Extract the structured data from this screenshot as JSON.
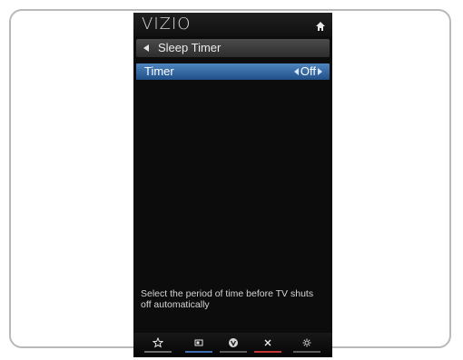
{
  "header": {
    "brand": "VIZIO"
  },
  "breadcrumb": {
    "label": "Sleep Timer"
  },
  "menu": {
    "row_label": "Timer",
    "row_value": "Off"
  },
  "description": {
    "text": "Select the period of time before TV shuts off automatically"
  },
  "bottom_bar": {
    "items": [
      {
        "icon": "star-icon",
        "label": "☆"
      },
      {
        "icon": "rectangle-icon",
        "label": "▭"
      },
      {
        "icon": "v-icon",
        "label": "V"
      },
      {
        "icon": "close-icon",
        "label": "x"
      },
      {
        "icon": "gear-icon",
        "label": "⚙"
      }
    ],
    "accent_colors": [
      "#6b6b6b",
      "#3f6fb1",
      "#5b5b5b",
      "#c33737",
      "#5d5d5d"
    ]
  }
}
